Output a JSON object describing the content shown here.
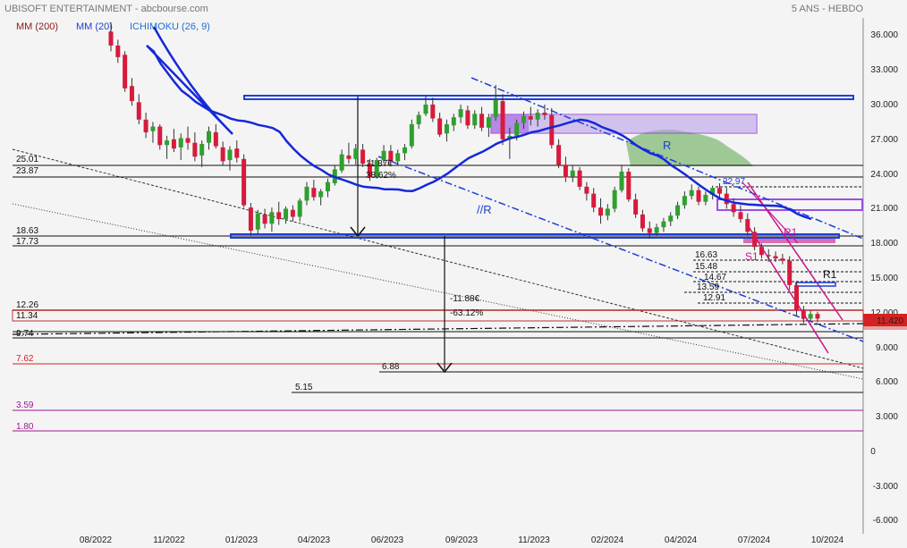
{
  "header": {
    "title": "UBISOFT ENTERTAINMENT - abcbourse.com",
    "period": "5 ANS - HEBDO",
    "legend": [
      {
        "label": "MM (200)",
        "color": "#8b1a1a"
      },
      {
        "label": "MM (20)",
        "color": "#1f3fd6"
      },
      {
        "label": "ICHIMOKU (26, 9)",
        "color": "#1f6fd6"
      }
    ]
  },
  "colors": {
    "up": "#2ea02e",
    "down": "#d81a3c",
    "mm20": "#1528d8",
    "channel": "#1f3fd6",
    "pink": "#c8148c",
    "cloud": "#8fbf86",
    "rect": "#9b4fe0",
    "price_tag": "#d42222"
  },
  "chart_data": {
    "type": "candlestick",
    "ylim": [
      -6,
      38
    ],
    "y_ticks": [
      "36.000",
      "33.000",
      "30.000",
      "27.000",
      "24.000",
      "21.000",
      "18.000",
      "15.000",
      "12.000",
      "9.000",
      "6.000",
      "3.000",
      "0",
      "-3.000",
      "-6.000"
    ],
    "x_ticks": [
      "08/2022",
      "11/2022",
      "01/2023",
      "04/2023",
      "06/2023",
      "09/2023",
      "11/2023",
      "02/2024",
      "04/2024",
      "07/2024",
      "10/2024"
    ],
    "last_price": "11.420",
    "levels_left": [
      "25.01",
      "23.87",
      "18.63",
      "17.73",
      "12.26",
      "11.34",
      "9.74",
      "7.62",
      "3.59",
      "1.80"
    ],
    "levels_inner": [
      "6.88",
      "5.15",
      "16.63",
      "15.48",
      "14.67",
      "13.59",
      "12.91",
      "22.97"
    ],
    "annotations": [
      "11.87€",
      "38.62%",
      "-11.88€",
      "-63.12%",
      "R",
      "//R",
      "R1",
      "S1",
      "R1",
      "R1"
    ],
    "candles": [
      [
        36.2,
        37.0,
        34.5,
        35.0
      ],
      [
        35.0,
        35.5,
        33.5,
        34.0
      ],
      [
        34.2,
        34.5,
        31.0,
        31.3
      ],
      [
        31.5,
        32.2,
        29.8,
        30.2
      ],
      [
        30.1,
        30.8,
        28.2,
        28.6
      ],
      [
        28.6,
        29.2,
        27.0,
        27.5
      ],
      [
        27.6,
        28.4,
        26.6,
        28.0
      ],
      [
        28.0,
        28.2,
        26.0,
        26.4
      ],
      [
        26.4,
        27.2,
        25.2,
        26.8
      ],
      [
        26.9,
        27.8,
        25.8,
        26.1
      ],
      [
        26.2,
        27.4,
        25.1,
        27.0
      ],
      [
        27.0,
        28.0,
        26.0,
        26.6
      ],
      [
        26.6,
        27.5,
        25.0,
        25.4
      ],
      [
        25.5,
        26.8,
        24.5,
        26.5
      ],
      [
        26.6,
        28.0,
        26.0,
        27.6
      ],
      [
        27.5,
        28.2,
        26.1,
        26.3
      ],
      [
        26.2,
        26.7,
        24.6,
        25.0
      ],
      [
        25.1,
        26.3,
        24.2,
        26.0
      ],
      [
        26.1,
        26.8,
        24.9,
        25.3
      ],
      [
        25.2,
        25.6,
        21.0,
        21.2
      ],
      [
        21.0,
        21.4,
        18.6,
        19.0
      ],
      [
        19.1,
        20.8,
        18.7,
        20.5
      ],
      [
        20.4,
        20.9,
        19.2,
        19.6
      ],
      [
        19.6,
        21.0,
        18.9,
        20.6
      ],
      [
        20.6,
        21.5,
        19.5,
        20.0
      ],
      [
        20.0,
        21.1,
        19.6,
        20.9
      ],
      [
        20.8,
        21.2,
        19.8,
        20.2
      ],
      [
        20.2,
        21.8,
        19.8,
        21.6
      ],
      [
        21.6,
        23.2,
        21.2,
        22.8
      ],
      [
        22.7,
        23.4,
        21.6,
        21.9
      ],
      [
        21.9,
        22.6,
        21.2,
        22.4
      ],
      [
        22.4,
        23.5,
        21.9,
        23.2
      ],
      [
        23.1,
        24.6,
        22.9,
        24.3
      ],
      [
        24.2,
        26.0,
        24.0,
        25.6
      ],
      [
        25.5,
        26.6,
        24.8,
        25.2
      ],
      [
        25.2,
        26.5,
        24.7,
        26.1
      ],
      [
        26.0,
        26.5,
        24.5,
        24.8
      ],
      [
        24.8,
        25.2,
        23.3,
        23.6
      ],
      [
        23.7,
        25.3,
        23.5,
        25.1
      ],
      [
        25.1,
        26.4,
        24.8,
        25.9
      ],
      [
        25.9,
        26.4,
        24.7,
        25.0
      ],
      [
        25.0,
        26.0,
        24.6,
        25.7
      ],
      [
        25.7,
        26.5,
        25.1,
        26.2
      ],
      [
        26.3,
        28.6,
        26.1,
        28.2
      ],
      [
        28.2,
        29.3,
        27.8,
        29.0
      ],
      [
        29.1,
        30.6,
        28.9,
        29.9
      ],
      [
        29.9,
        30.5,
        28.4,
        28.7
      ],
      [
        28.7,
        29.2,
        27.1,
        27.3
      ],
      [
        27.4,
        28.6,
        26.7,
        28.2
      ],
      [
        28.1,
        29.1,
        27.6,
        28.8
      ],
      [
        28.8,
        29.9,
        28.3,
        29.5
      ],
      [
        29.4,
        29.8,
        27.8,
        28.1
      ],
      [
        28.1,
        29.4,
        27.8,
        29.1
      ],
      [
        29.1,
        29.7,
        27.6,
        27.9
      ],
      [
        27.9,
        29.1,
        27.1,
        28.8
      ],
      [
        28.8,
        31.6,
        28.5,
        30.3
      ],
      [
        30.2,
        30.8,
        26.4,
        26.9
      ],
      [
        26.9,
        27.9,
        25.2,
        27.2
      ],
      [
        27.2,
        28.6,
        26.8,
        28.3
      ],
      [
        28.3,
        29.3,
        27.8,
        28.9
      ],
      [
        28.9,
        29.7,
        28.1,
        28.6
      ],
      [
        28.6,
        29.5,
        28.0,
        29.2
      ],
      [
        29.2,
        29.9,
        28.6,
        29.0
      ],
      [
        29.0,
        29.6,
        26.1,
        26.4
      ],
      [
        26.4,
        26.9,
        24.4,
        24.7
      ],
      [
        24.7,
        25.4,
        23.2,
        23.6
      ],
      [
        23.7,
        24.6,
        23.2,
        24.2
      ],
      [
        24.2,
        24.5,
        22.5,
        22.8
      ],
      [
        22.8,
        23.2,
        21.6,
        22.2
      ],
      [
        22.2,
        22.7,
        20.6,
        21.0
      ],
      [
        21.0,
        21.8,
        19.6,
        20.3
      ],
      [
        20.3,
        21.3,
        19.9,
        20.9
      ],
      [
        20.9,
        22.8,
        20.6,
        22.5
      ],
      [
        22.5,
        24.7,
        22.3,
        24.1
      ],
      [
        24.1,
        24.4,
        21.5,
        21.7
      ],
      [
        21.7,
        22.2,
        20.1,
        20.4
      ],
      [
        20.4,
        20.8,
        18.9,
        19.2
      ],
      [
        19.2,
        19.8,
        18.3,
        18.8
      ],
      [
        18.8,
        19.6,
        18.5,
        19.3
      ],
      [
        19.3,
        20.1,
        18.9,
        19.8
      ],
      [
        19.8,
        20.6,
        19.4,
        20.3
      ],
      [
        20.3,
        21.5,
        20.0,
        21.2
      ],
      [
        21.2,
        22.4,
        20.9,
        22.0
      ],
      [
        22.0,
        23.0,
        21.7,
        22.5
      ],
      [
        22.5,
        22.8,
        21.2,
        21.5
      ],
      [
        21.5,
        22.4,
        21.2,
        22.1
      ],
      [
        22.1,
        22.9,
        21.7,
        22.7
      ],
      [
        22.7,
        23.1,
        21.9,
        22.2
      ],
      [
        22.2,
        22.7,
        20.9,
        21.3
      ],
      [
        21.3,
        21.8,
        20.2,
        20.6
      ],
      [
        20.6,
        21.2,
        19.7,
        20.0
      ],
      [
        20.0,
        20.5,
        18.6,
        18.9
      ],
      [
        18.9,
        19.3,
        17.3,
        17.6
      ],
      [
        17.6,
        17.9,
        16.6,
        16.9
      ],
      [
        16.9,
        17.4,
        16.3,
        16.8
      ],
      [
        16.8,
        17.2,
        16.3,
        16.6
      ],
      [
        16.6,
        17.0,
        16.1,
        16.4
      ],
      [
        16.4,
        16.8,
        13.9,
        14.3
      ],
      [
        14.3,
        14.6,
        11.6,
        12.1
      ],
      [
        12.1,
        12.5,
        11.0,
        11.4
      ],
      [
        11.4,
        12.1,
        11.2,
        11.8
      ],
      [
        11.8,
        12.0,
        11.1,
        11.4
      ]
    ]
  }
}
